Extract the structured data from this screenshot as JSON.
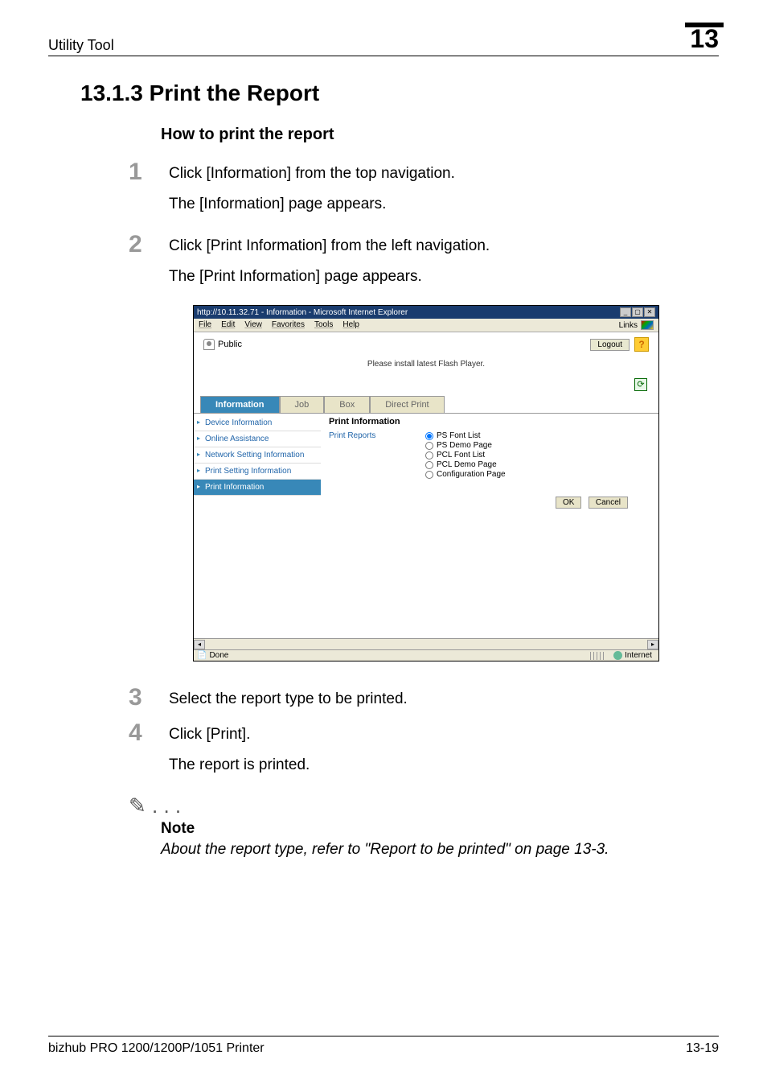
{
  "header": {
    "left": "Utility Tool",
    "right": "13"
  },
  "section_heading": "13.1.3  Print the Report",
  "sub_heading": "How to print the report",
  "steps": [
    {
      "num": "1",
      "text": "Click [Information] from the top navigation.",
      "sub": "The [Information] page appears."
    },
    {
      "num": "2",
      "text": "Click [Print Information] from the left navigation.",
      "sub": "The [Print Information] page appears."
    },
    {
      "num": "3",
      "text": "Select the report type to be printed.",
      "sub": ""
    },
    {
      "num": "4",
      "text": "Click [Print].",
      "sub": "The report is printed."
    }
  ],
  "ie": {
    "title": "http://10.11.32.71 - Information - Microsoft Internet Explorer",
    "menu": [
      "File",
      "Edit",
      "View",
      "Favorites",
      "Tools",
      "Help"
    ],
    "links_label": "Links",
    "user_label": "Public",
    "logout": "Logout",
    "help": "?",
    "flash_msg": "Please install latest Flash Player.",
    "refresh": "⟳",
    "tabs": [
      "Information",
      "Job",
      "Box",
      "Direct Print"
    ],
    "sidebar": [
      "Device Information",
      "Online Assistance",
      "Network Setting Information",
      "Print Setting Information",
      "Print Information"
    ],
    "content_title": "Print Information",
    "print_reports_label": "Print Reports",
    "radios": [
      "PS Font List",
      "PS Demo Page",
      "PCL Font List",
      "PCL Demo Page",
      "Configuration Page"
    ],
    "ok": "OK",
    "cancel": "Cancel",
    "status_done": "Done",
    "status_zone": "Internet",
    "scroll_left": "◂",
    "scroll_right": "▸",
    "win_min": "_",
    "win_max": "▢",
    "win_close": "✕"
  },
  "note": {
    "icon": "✎ . . .",
    "heading": "Note",
    "text": "About the report type, refer to \"Report to be printed\" on page 13-3."
  },
  "footer": {
    "left": "bizhub PRO 1200/1200P/1051 Printer",
    "right": "13-19"
  }
}
